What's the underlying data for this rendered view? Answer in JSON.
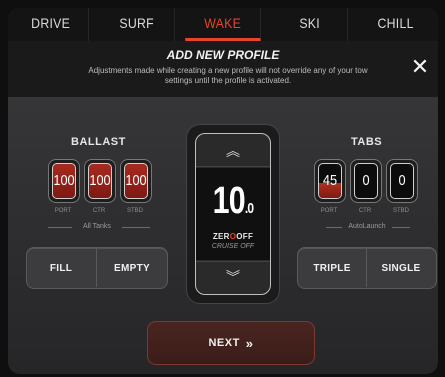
{
  "tabs": [
    {
      "label": "DRIVE",
      "active": false
    },
    {
      "label": "SURF",
      "active": false
    },
    {
      "label": "WAKE",
      "active": true
    },
    {
      "label": "SKI",
      "active": false
    },
    {
      "label": "CHILL",
      "active": false
    }
  ],
  "banner": {
    "title": "ADD NEW PROFILE",
    "subtitle": "Adjustments made while creating a new profile will not override any of your tow settings until the profile is activated."
  },
  "ballast": {
    "heading": "BALLAST",
    "tanks": [
      {
        "value": "100",
        "label": "PORT"
      },
      {
        "value": "100",
        "label": "CTR"
      },
      {
        "value": "100",
        "label": "STBD"
      }
    ],
    "group_label": "All Tanks",
    "fill_label": "FILL",
    "empty_label": "EMPTY"
  },
  "speed": {
    "whole": "10",
    "decimal": ".0",
    "brand_left": "ZER",
    "brand_o": "O",
    "brand_right": "OFF",
    "status": "CRUISE OFF",
    "up_icon": "chevron-up-double-icon",
    "down_icon": "chevron-down-double-icon"
  },
  "tabs_section": {
    "heading": "TABS",
    "tabs": [
      {
        "value": "45",
        "label": "PORT",
        "fill": 0.45
      },
      {
        "value": "0",
        "label": "CTR",
        "fill": 0
      },
      {
        "value": "0",
        "label": "STBD",
        "fill": 0
      }
    ],
    "group_label": "AutoLaunch",
    "triple_label": "TRIPLE",
    "single_label": "SINGLE"
  },
  "next_label": "NEXT",
  "colors": {
    "accent": "#e8432b",
    "fill_red": "#a82a20"
  }
}
